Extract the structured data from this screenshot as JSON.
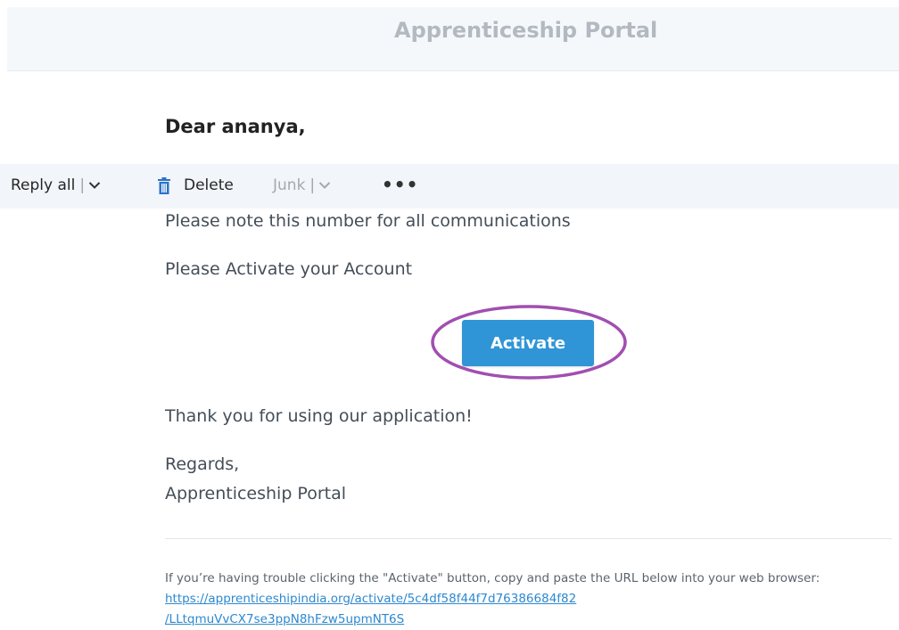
{
  "header": {
    "title": "Apprenticeship Portal"
  },
  "email": {
    "greeting": "Dear ananya,",
    "line_number_note": "Please note this number for all communications",
    "line_activate": "Please Activate your Account",
    "activate_button": "Activate",
    "thanks": "Thank you for using our application!",
    "regards": "Regards,",
    "signature": "Apprenticeship Portal",
    "trouble_text": "If you’re having trouble clicking the \"Activate\" button, copy and paste the URL below into your web browser: ",
    "activation_url_line1": "https://apprenticeshipindia.org/activate/5c4df58f44f7d76386684f82",
    "activation_url_line2": "/LLtqmuVvCX7se3ppN8hFzw5upmNT6S"
  },
  "toolbar": {
    "reply_all": "Reply all",
    "separator": "|",
    "delete": "Delete",
    "junk": "Junk",
    "more": "•••",
    "icons": {
      "reply_dropdown": "chevron-down-icon",
      "delete": "trash-icon",
      "junk_dropdown": "chevron-down-icon",
      "more": "more-icon"
    }
  },
  "colors": {
    "button": "#2f95d6",
    "highlight_ring": "#a14fb0",
    "link": "#2d88cf",
    "trash_icon": "#2b73c7",
    "toolbar_bg": "#f2f6fb",
    "header_bg": "#f5f8fb"
  }
}
